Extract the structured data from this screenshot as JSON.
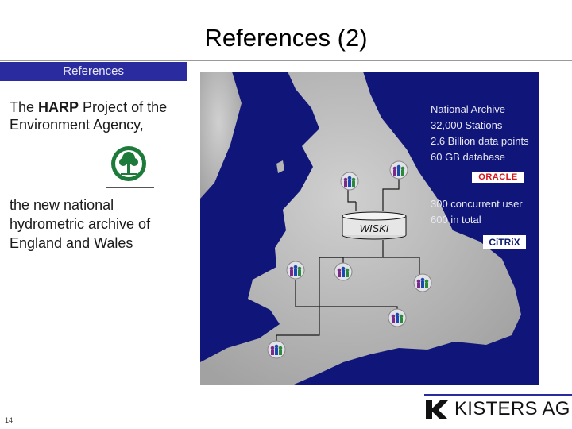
{
  "slide": {
    "title": "References (2)",
    "section_label": "References",
    "intro_prefix": "The ",
    "intro_bold": "HARP",
    "intro_suffix": " Project of the Environment Agency,",
    "description": "the new national hydrometric archive of England and Wales",
    "page_number": "14"
  },
  "map": {
    "archive_notes": [
      "National Archive",
      "32,000 Stations",
      "2.6 Billion data points",
      "60 GB database"
    ],
    "oracle_label": "ORACLE",
    "user_notes": [
      "300 concurrent user",
      "600 in total"
    ],
    "citrix_label": "CiTRiX",
    "server_label": "WISKI",
    "colors": {
      "sea": "#10157a",
      "land": "#b9b9b9",
      "lines": "#1a1a1a"
    },
    "node_icons": [
      "users-icon",
      "users-icon",
      "users-icon",
      "users-icon",
      "users-icon",
      "users-icon",
      "users-icon",
      "users-icon",
      "users-icon",
      "users-icon"
    ]
  },
  "brand": {
    "company": "KISTERS AG",
    "accent": "#2b2ba0"
  }
}
